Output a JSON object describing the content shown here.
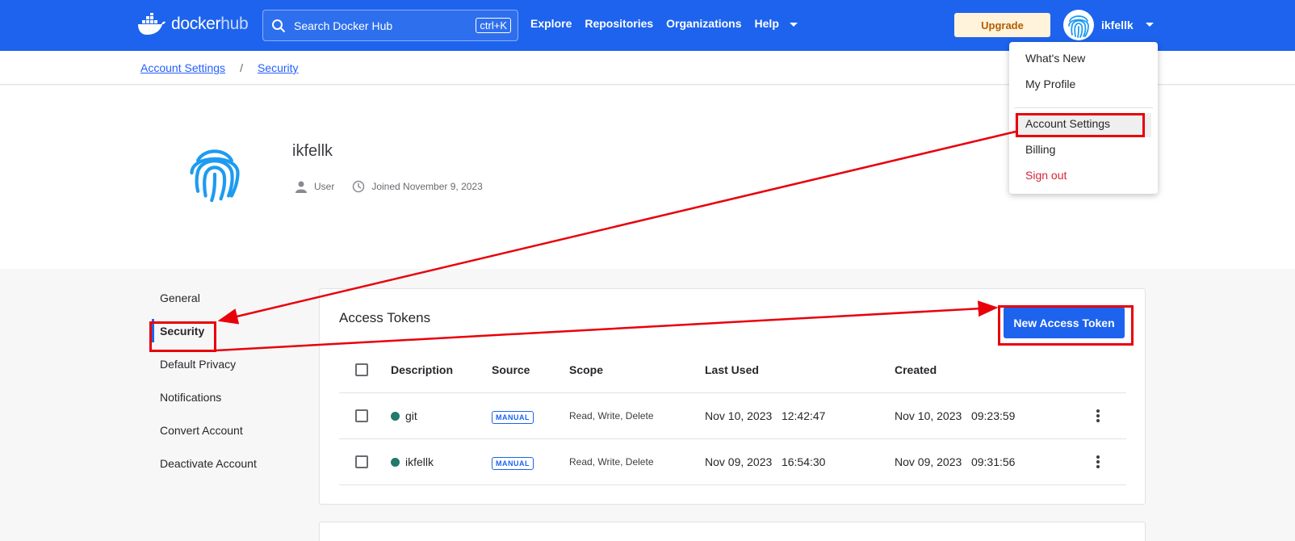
{
  "header": {
    "logo_text_docker": "docker",
    "logo_text_hub": "hub",
    "search_placeholder": "Search Docker Hub",
    "search_shortcut": "ctrl+K",
    "nav": [
      "Explore",
      "Repositories",
      "Organizations",
      "Help"
    ],
    "upgrade_label": "Upgrade",
    "username": "ikfellk"
  },
  "breadcrumb": {
    "items": [
      "Account Settings",
      "Security"
    ],
    "separator": "/"
  },
  "profile": {
    "name": "ikfellk",
    "role": "User",
    "joined": "Joined November 9, 2023"
  },
  "sidebar": {
    "items": [
      "General",
      "Security",
      "Default Privacy",
      "Notifications",
      "Convert Account",
      "Deactivate Account"
    ],
    "active": "Security"
  },
  "tokens": {
    "title": "Access Tokens",
    "new_button": "New Access Token",
    "columns": [
      "Description",
      "Source",
      "Scope",
      "Last Used",
      "Created"
    ],
    "rows": [
      {
        "description": "git",
        "source": "MANUAL",
        "scope": "Read, Write, Delete",
        "last_used": "Nov 10, 2023   12:42:47",
        "created": "Nov 10, 2023   09:23:59"
      },
      {
        "description": "ikfellk",
        "source": "MANUAL",
        "scope": "Read, Write, Delete",
        "last_used": "Nov 09, 2023   16:54:30",
        "created": "Nov 09, 2023   09:31:56"
      }
    ]
  },
  "user_menu": {
    "items": [
      "What's New",
      "My Profile",
      "Account Settings",
      "Billing",
      "Sign out"
    ]
  },
  "colors": {
    "brand_blue": "#1d63ed",
    "annotation_red": "#e8000b",
    "status_dot": "#217a6b",
    "danger": "#d52536"
  }
}
